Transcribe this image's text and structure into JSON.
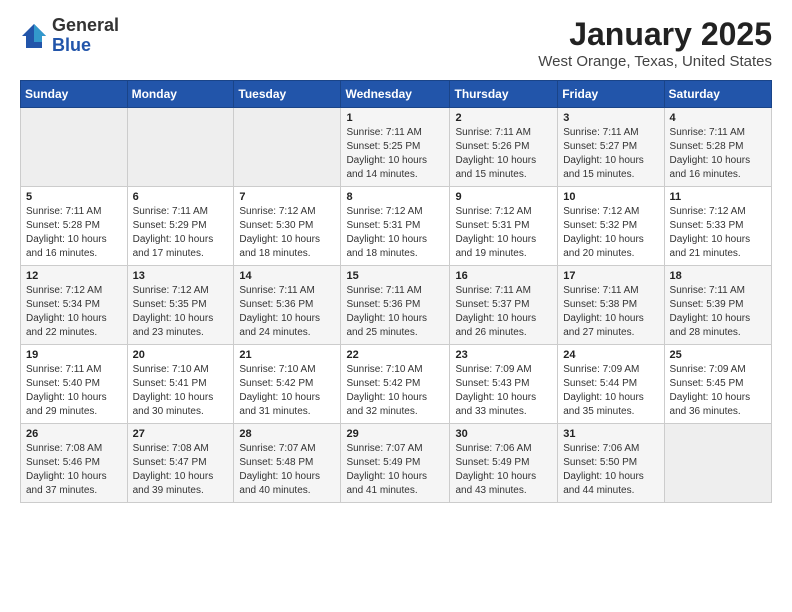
{
  "logo": {
    "general": "General",
    "blue": "Blue"
  },
  "title": {
    "month": "January 2025",
    "location": "West Orange, Texas, United States"
  },
  "weekdays": [
    "Sunday",
    "Monday",
    "Tuesday",
    "Wednesday",
    "Thursday",
    "Friday",
    "Saturday"
  ],
  "weeks": [
    [
      {
        "day": "",
        "info": ""
      },
      {
        "day": "",
        "info": ""
      },
      {
        "day": "",
        "info": ""
      },
      {
        "day": "1",
        "info": "Sunrise: 7:11 AM\nSunset: 5:25 PM\nDaylight: 10 hours\nand 14 minutes."
      },
      {
        "day": "2",
        "info": "Sunrise: 7:11 AM\nSunset: 5:26 PM\nDaylight: 10 hours\nand 15 minutes."
      },
      {
        "day": "3",
        "info": "Sunrise: 7:11 AM\nSunset: 5:27 PM\nDaylight: 10 hours\nand 15 minutes."
      },
      {
        "day": "4",
        "info": "Sunrise: 7:11 AM\nSunset: 5:28 PM\nDaylight: 10 hours\nand 16 minutes."
      }
    ],
    [
      {
        "day": "5",
        "info": "Sunrise: 7:11 AM\nSunset: 5:28 PM\nDaylight: 10 hours\nand 16 minutes."
      },
      {
        "day": "6",
        "info": "Sunrise: 7:11 AM\nSunset: 5:29 PM\nDaylight: 10 hours\nand 17 minutes."
      },
      {
        "day": "7",
        "info": "Sunrise: 7:12 AM\nSunset: 5:30 PM\nDaylight: 10 hours\nand 18 minutes."
      },
      {
        "day": "8",
        "info": "Sunrise: 7:12 AM\nSunset: 5:31 PM\nDaylight: 10 hours\nand 18 minutes."
      },
      {
        "day": "9",
        "info": "Sunrise: 7:12 AM\nSunset: 5:31 PM\nDaylight: 10 hours\nand 19 minutes."
      },
      {
        "day": "10",
        "info": "Sunrise: 7:12 AM\nSunset: 5:32 PM\nDaylight: 10 hours\nand 20 minutes."
      },
      {
        "day": "11",
        "info": "Sunrise: 7:12 AM\nSunset: 5:33 PM\nDaylight: 10 hours\nand 21 minutes."
      }
    ],
    [
      {
        "day": "12",
        "info": "Sunrise: 7:12 AM\nSunset: 5:34 PM\nDaylight: 10 hours\nand 22 minutes."
      },
      {
        "day": "13",
        "info": "Sunrise: 7:12 AM\nSunset: 5:35 PM\nDaylight: 10 hours\nand 23 minutes."
      },
      {
        "day": "14",
        "info": "Sunrise: 7:11 AM\nSunset: 5:36 PM\nDaylight: 10 hours\nand 24 minutes."
      },
      {
        "day": "15",
        "info": "Sunrise: 7:11 AM\nSunset: 5:36 PM\nDaylight: 10 hours\nand 25 minutes."
      },
      {
        "day": "16",
        "info": "Sunrise: 7:11 AM\nSunset: 5:37 PM\nDaylight: 10 hours\nand 26 minutes."
      },
      {
        "day": "17",
        "info": "Sunrise: 7:11 AM\nSunset: 5:38 PM\nDaylight: 10 hours\nand 27 minutes."
      },
      {
        "day": "18",
        "info": "Sunrise: 7:11 AM\nSunset: 5:39 PM\nDaylight: 10 hours\nand 28 minutes."
      }
    ],
    [
      {
        "day": "19",
        "info": "Sunrise: 7:11 AM\nSunset: 5:40 PM\nDaylight: 10 hours\nand 29 minutes."
      },
      {
        "day": "20",
        "info": "Sunrise: 7:10 AM\nSunset: 5:41 PM\nDaylight: 10 hours\nand 30 minutes."
      },
      {
        "day": "21",
        "info": "Sunrise: 7:10 AM\nSunset: 5:42 PM\nDaylight: 10 hours\nand 31 minutes."
      },
      {
        "day": "22",
        "info": "Sunrise: 7:10 AM\nSunset: 5:42 PM\nDaylight: 10 hours\nand 32 minutes."
      },
      {
        "day": "23",
        "info": "Sunrise: 7:09 AM\nSunset: 5:43 PM\nDaylight: 10 hours\nand 33 minutes."
      },
      {
        "day": "24",
        "info": "Sunrise: 7:09 AM\nSunset: 5:44 PM\nDaylight: 10 hours\nand 35 minutes."
      },
      {
        "day": "25",
        "info": "Sunrise: 7:09 AM\nSunset: 5:45 PM\nDaylight: 10 hours\nand 36 minutes."
      }
    ],
    [
      {
        "day": "26",
        "info": "Sunrise: 7:08 AM\nSunset: 5:46 PM\nDaylight: 10 hours\nand 37 minutes."
      },
      {
        "day": "27",
        "info": "Sunrise: 7:08 AM\nSunset: 5:47 PM\nDaylight: 10 hours\nand 39 minutes."
      },
      {
        "day": "28",
        "info": "Sunrise: 7:07 AM\nSunset: 5:48 PM\nDaylight: 10 hours\nand 40 minutes."
      },
      {
        "day": "29",
        "info": "Sunrise: 7:07 AM\nSunset: 5:49 PM\nDaylight: 10 hours\nand 41 minutes."
      },
      {
        "day": "30",
        "info": "Sunrise: 7:06 AM\nSunset: 5:49 PM\nDaylight: 10 hours\nand 43 minutes."
      },
      {
        "day": "31",
        "info": "Sunrise: 7:06 AM\nSunset: 5:50 PM\nDaylight: 10 hours\nand 44 minutes."
      },
      {
        "day": "",
        "info": ""
      }
    ]
  ]
}
